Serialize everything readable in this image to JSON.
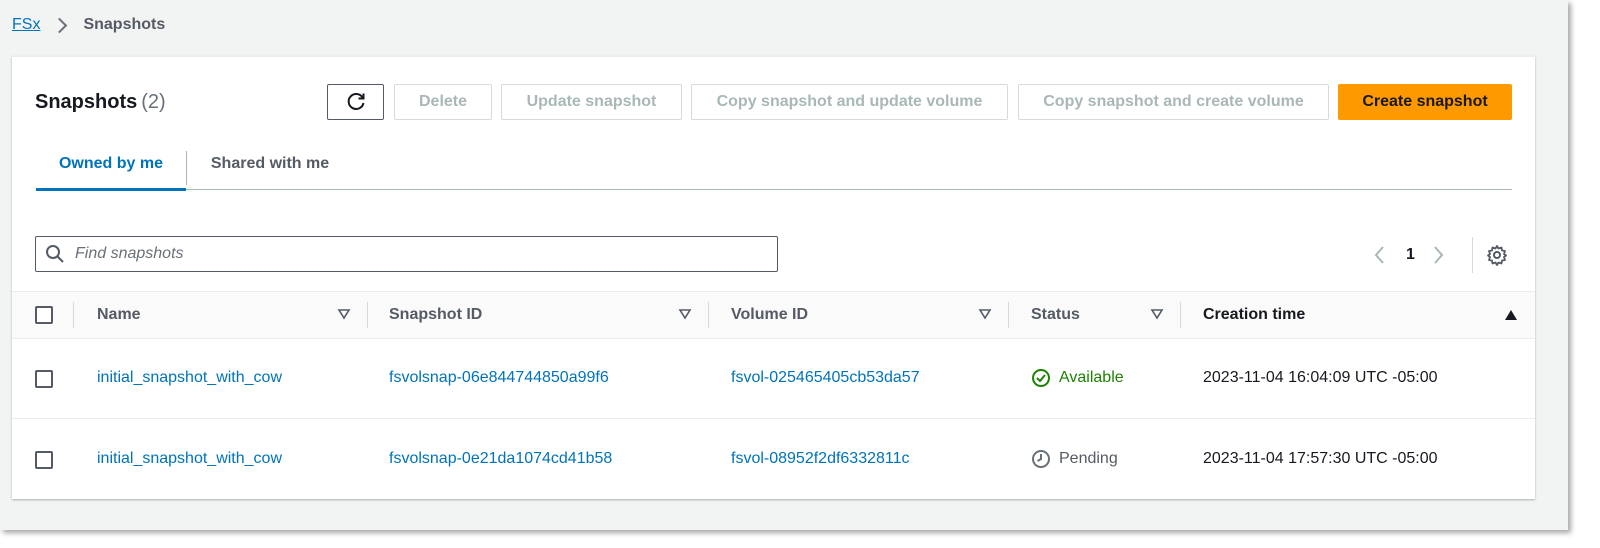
{
  "breadcrumb": {
    "root": "FSx",
    "current": "Snapshots"
  },
  "header": {
    "title": "Snapshots",
    "count": "(2)"
  },
  "actions": {
    "delete": "Delete",
    "update": "Update snapshot",
    "copy_update": "Copy snapshot and update volume",
    "copy_create": "Copy snapshot and create volume",
    "create": "Create snapshot"
  },
  "tabs": [
    {
      "label": "Owned by me",
      "active": true
    },
    {
      "label": "Shared with me",
      "active": false
    }
  ],
  "search": {
    "placeholder": "Find snapshots"
  },
  "pagination": {
    "current_page": "1"
  },
  "table": {
    "columns": [
      "Name",
      "Snapshot ID",
      "Volume ID",
      "Status",
      "Creation time"
    ],
    "rows": [
      {
        "name": "initial_snapshot_with_cow",
        "snapshot_id": "fsvolsnap-06e844744850a99f6",
        "volume_id": "fsvol-025465405cb53da57",
        "status": "Available",
        "creation_time": "2023-11-04 16:04:09 UTC -05:00"
      },
      {
        "name": "initial_snapshot_with_cow",
        "snapshot_id": "fsvolsnap-0e21da1074cd41b58",
        "volume_id": "fsvol-08952f2df6332811c",
        "status": "Pending",
        "creation_time": "2023-11-04 17:57:30 UTC -05:00"
      }
    ]
  },
  "colors": {
    "link": "#0073bb",
    "primary": "#ff9900",
    "success": "#1d8102",
    "muted": "#545b64"
  }
}
